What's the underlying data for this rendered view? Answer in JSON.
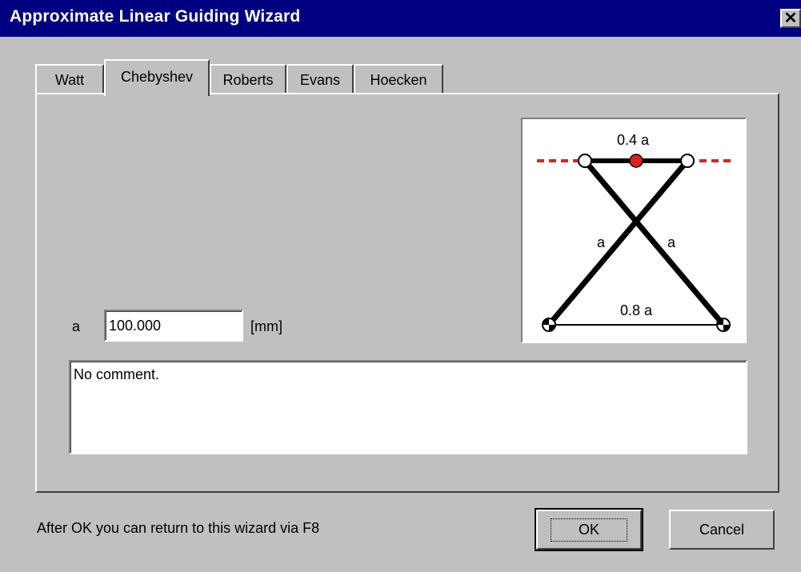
{
  "window": {
    "title": "Approximate Linear Guiding Wizard",
    "close_glyph": "✕"
  },
  "tabs": [
    {
      "label": "Watt",
      "active": false
    },
    {
      "label": "Chebyshev",
      "active": true
    },
    {
      "label": "Roberts",
      "active": false
    },
    {
      "label": "Evans",
      "active": false
    },
    {
      "label": "Hoecken",
      "active": false
    }
  ],
  "params": {
    "a_label": "a",
    "a_value": "100.000",
    "a_unit": "[mm]"
  },
  "comment": "No comment.",
  "diagram": {
    "top_label": "0.4 a",
    "left_label": "a",
    "right_label": "a",
    "bottom_label": "0.8 a",
    "colors": {
      "guide_line": "#e02020",
      "coupler_point": "#e02020",
      "link": "#000000"
    }
  },
  "footer": {
    "hint": "After OK you can return to this wizard via F8",
    "ok_label": "OK",
    "cancel_label": "Cancel"
  }
}
